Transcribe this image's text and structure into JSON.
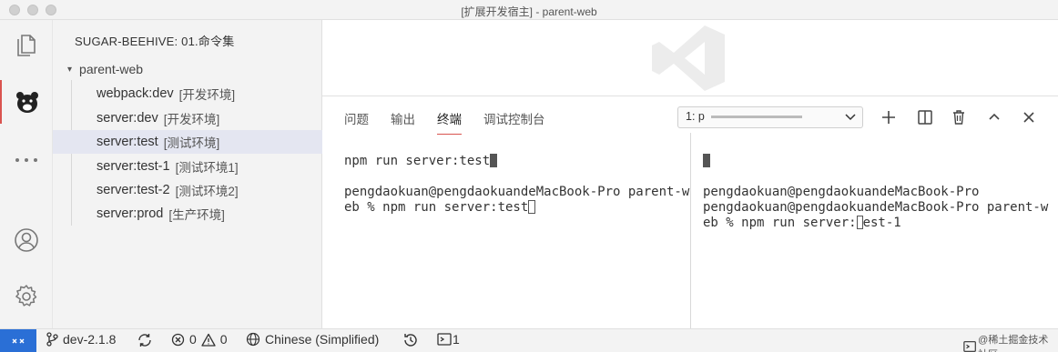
{
  "window": {
    "title": "[扩展开发宿主] - parent-web"
  },
  "activity_bar": {
    "items": [
      "explorer",
      "bear-extension",
      "more",
      "accounts",
      "settings"
    ]
  },
  "sidebar": {
    "title": "SUGAR-BEEHIVE: 01.命令集",
    "root": "parent-web",
    "items": [
      {
        "name": "webpack:dev",
        "env": "[开发环境]"
      },
      {
        "name": "server:dev",
        "env": "[开发环境]"
      },
      {
        "name": "server:test",
        "env": "[测试环境]"
      },
      {
        "name": "server:test-1",
        "env": "[测试环境1]"
      },
      {
        "name": "server:test-2",
        "env": "[测试环境2]"
      },
      {
        "name": "server:prod",
        "env": "[生产环境]"
      }
    ]
  },
  "panel": {
    "tabs": [
      {
        "label": "问题"
      },
      {
        "label": "输出"
      },
      {
        "label": "终端"
      },
      {
        "label": "调试控制台"
      }
    ],
    "terminal_select": "1: p",
    "left_pane": {
      "line1": "npm run server:test",
      "line2": "pengdaokuan@pengdaokuandeMacBook-Pro parent-w",
      "line3": "eb % npm run server:test"
    },
    "right_pane": {
      "line2": "pengdaokuan@pengdaokuandeMacBook-Pro",
      "line3": "pengdaokuan@pengdaokuandeMacBook-Pro parent-w",
      "line4_pre": "eb % npm run server:",
      "line4_post": "est-1"
    }
  },
  "status_bar": {
    "branch": "dev-2.1.8",
    "errors": "0",
    "warnings": "0",
    "language": "Chinese (Simplified)",
    "terminals": "1",
    "watermark": "@稀土掘金技术社区"
  },
  "colors": {
    "accent": "#d9534f",
    "remote": "#2a6fd6",
    "selected": "#e4e6f1"
  }
}
